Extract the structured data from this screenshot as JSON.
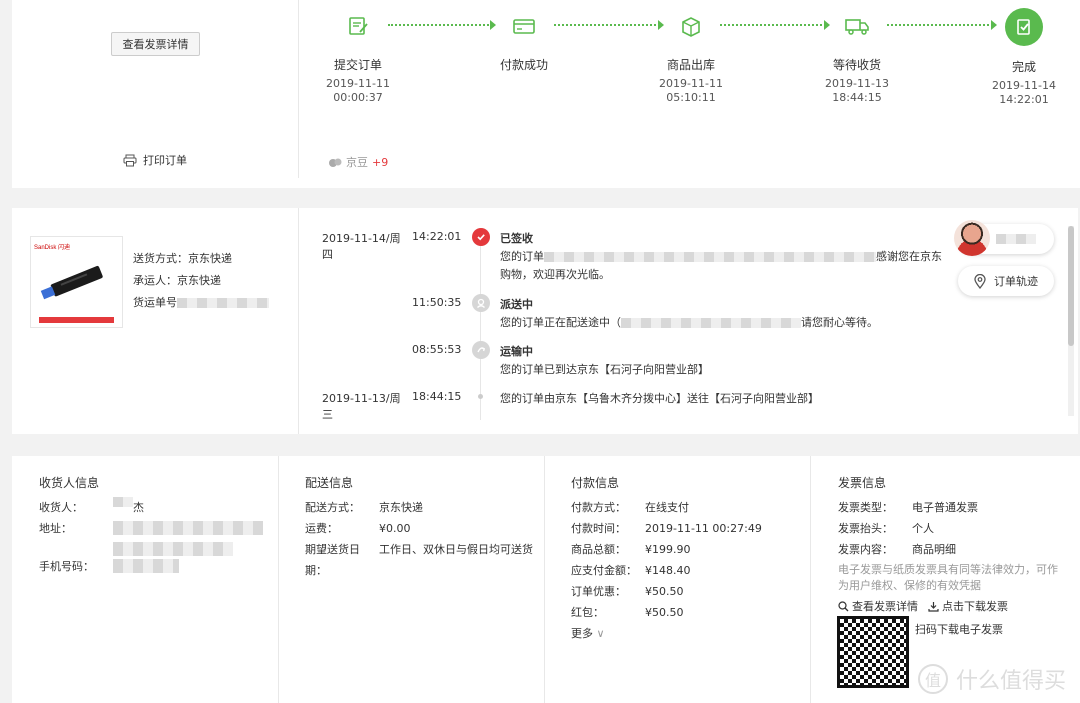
{
  "top": {
    "invoice_btn": "查看发票详情",
    "print_label": "打印订单",
    "beans_label": "京豆",
    "beans_value": "+9",
    "steps": [
      {
        "name": "提交订单",
        "date": "2019-11-11",
        "time": "00:00:37",
        "icon": "submit-order-icon"
      },
      {
        "name": "付款成功",
        "date": "",
        "time": "",
        "icon": "payment-card-icon"
      },
      {
        "name": "商品出库",
        "date": "2019-11-11",
        "time": "05:10:11",
        "icon": "package-out-icon"
      },
      {
        "name": "等待收货",
        "date": "2019-11-13",
        "time": "18:44:15",
        "icon": "delivery-truck-icon"
      },
      {
        "name": "完成",
        "date": "2019-11-14",
        "time": "14:22:01",
        "icon": "complete-check-icon"
      }
    ],
    "accent": "#5aba4e"
  },
  "logistics": {
    "ship_method_label": "送货方式：",
    "ship_method": "京东快递",
    "carrier_label": "承运人：",
    "carrier": "京东快递",
    "tracking_label": "货运单号",
    "track_button": "订单轨迹",
    "events": [
      {
        "date": "2019-11-14/周四",
        "time": "14:22:01",
        "title": "已签收",
        "text_a": "您的订单",
        "text_b": "感谢您在京东",
        "text_c": "购物，欢迎再次光临。"
      },
      {
        "date": "",
        "time": "11:50:35",
        "title": "派送中",
        "text_a": "您的订单正在配送途中（",
        "text_b": "请您耐心等待。",
        "text_c": ""
      },
      {
        "date": "",
        "time": "08:55:53",
        "title": "运输中",
        "text_a": "您的订单已到达京东【石河子向阳营业部】",
        "text_b": "",
        "text_c": ""
      },
      {
        "date": "2019-11-13/周三",
        "time": "18:44:15",
        "title": "",
        "text_a": "您的订单由京东【乌鲁木齐分拨中心】送往【石河子向阳营业部】",
        "text_b": "",
        "text_c": ""
      }
    ],
    "status_red": "#e4393c"
  },
  "receiver": {
    "title": "收货人信息",
    "name_label": "收货人：",
    "name_tail": "杰",
    "addr_label": "地址：",
    "phone_label": "手机号码："
  },
  "delivery": {
    "title": "配送信息",
    "rows": [
      {
        "k": "配送方式：",
        "v": "京东快递"
      },
      {
        "k": "运费：",
        "v": "¥0.00"
      },
      {
        "k": "期望送货日期：",
        "v": "工作日、双休日与假日均可送货"
      }
    ]
  },
  "payment": {
    "title": "付款信息",
    "rows": [
      {
        "k": "付款方式：",
        "v": "在线支付"
      },
      {
        "k": "付款时间：",
        "v": "2019-11-11 00:27:49"
      },
      {
        "k": "商品总额：",
        "v": "¥199.90"
      },
      {
        "k": "应支付金额：",
        "v": "¥148.40"
      },
      {
        "k": "订单优惠：",
        "v": "¥50.50"
      },
      {
        "k": "红包：",
        "v": "¥50.50"
      }
    ],
    "more": "更多"
  },
  "invoice": {
    "title": "发票信息",
    "rows": [
      {
        "k": "发票类型：",
        "v": "电子普通发票"
      },
      {
        "k": "发票抬头：",
        "v": "个人"
      },
      {
        "k": "发票内容：",
        "v": "商品明细"
      }
    ],
    "note": "电子发票与纸质发票具有同等法律效力，可作为用户维权、保修的有效凭据",
    "view_link": "查看发票详情",
    "download_link": "点击下载发票",
    "qr_text": "扫码下载电子发票"
  },
  "watermark": "什么值得买"
}
